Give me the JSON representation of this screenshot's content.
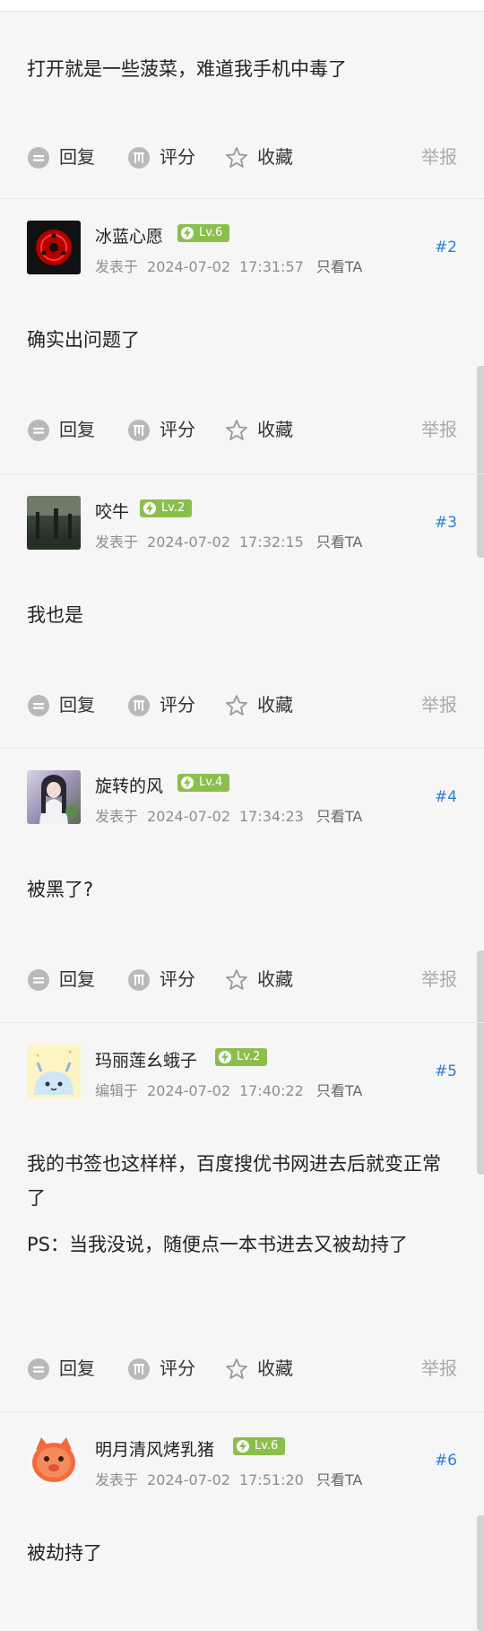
{
  "actions": {
    "reply": "回复",
    "rate": "评分",
    "favorite": "收藏",
    "report": "举报"
  },
  "first_post": {
    "content": "打开就是一些菠菜，难道我手机中毒了"
  },
  "posts": [
    {
      "username": "冰蓝心愿",
      "level": "Lv.6",
      "meta_label": "发表于",
      "date": "2024-07-02",
      "time": "17:31:57",
      "only_ta": "只看TA",
      "floor": "#2",
      "content": [
        "确实出问题了"
      ]
    },
    {
      "username": "咬牛",
      "level": "Lv.2",
      "meta_label": "发表于",
      "date": "2024-07-02",
      "time": "17:32:15",
      "only_ta": "只看TA",
      "floor": "#3",
      "content": [
        "我也是"
      ]
    },
    {
      "username": "旋转的风",
      "level": "Lv.4",
      "meta_label": "发表于",
      "date": "2024-07-02",
      "time": "17:34:23",
      "only_ta": "只看TA",
      "floor": "#4",
      "content": [
        "被黑了?"
      ]
    },
    {
      "username": "玛丽莲幺蛾子",
      "level": "Lv.2",
      "meta_label": "编辑于",
      "date": "2024-07-02",
      "time": "17:40:22",
      "only_ta": "只看TA",
      "floor": "#5",
      "content": [
        "我的书签也这样样，百度搜优书网进去后就变正常了",
        "PS：当我没说，随便点一本书进去又被劫持了"
      ]
    },
    {
      "username": "明月清风烤乳猪",
      "level": "Lv.6",
      "meta_label": "发表于",
      "date": "2024-07-02",
      "time": "17:51:20",
      "only_ta": "只看TA",
      "floor": "#6",
      "content": [
        "被劫持了"
      ]
    }
  ],
  "icons": {
    "reply": "reply-icon",
    "rate": "rate-icon",
    "favorite": "star-icon",
    "level": "bolt-icon"
  },
  "colors": {
    "accent_blue": "#2a7fd4",
    "level_green": "#8bbf4d",
    "muted_text": "#8e8e8e"
  }
}
